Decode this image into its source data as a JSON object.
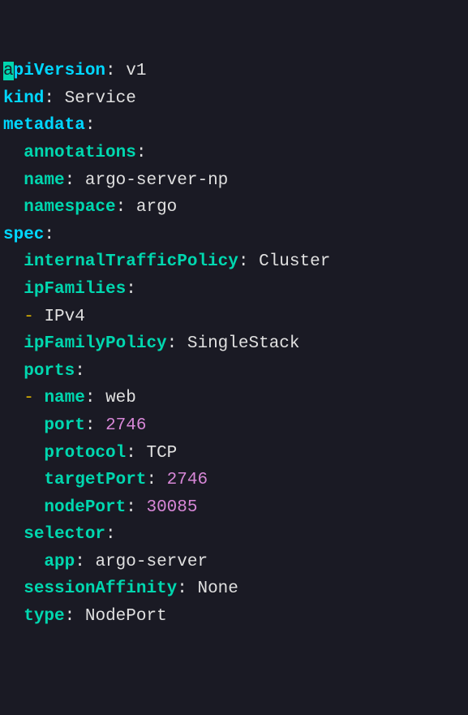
{
  "code": {
    "l1": {
      "key": "apiVersion",
      "value": "v1"
    },
    "l2": {
      "key": "kind",
      "value": "Service"
    },
    "l3": {
      "key": "metadata"
    },
    "l4": {
      "key": "annotations"
    },
    "l5": {
      "key": "name",
      "value": "argo-server-np"
    },
    "l6": {
      "key": "namespace",
      "value": "argo"
    },
    "l7": {
      "key": "spec"
    },
    "l8": {
      "key": "internalTrafficPolicy",
      "value": "Cluster"
    },
    "l9": {
      "key": "ipFamilies"
    },
    "l10": {
      "dash": "-",
      "value": "IPv4"
    },
    "l11": {
      "key": "ipFamilyPolicy",
      "value": "SingleStack"
    },
    "l12": {
      "key": "ports"
    },
    "l13": {
      "dash": "-",
      "key": "name",
      "value": "web"
    },
    "l14": {
      "key": "port",
      "value": "2746"
    },
    "l15": {
      "key": "protocol",
      "value": "TCP"
    },
    "l16": {
      "key": "targetPort",
      "value": "2746"
    },
    "l17": {
      "key": "nodePort",
      "value": "30085"
    },
    "l18": {
      "key": "selector"
    },
    "l19": {
      "key": "app",
      "value": "argo-server"
    },
    "l20": {
      "key": "sessionAffinity",
      "value": "None"
    },
    "l21": {
      "key": "type",
      "value": "NodePort"
    }
  },
  "colon": ":",
  "firstchar": "a",
  "restkey": "piVersion"
}
